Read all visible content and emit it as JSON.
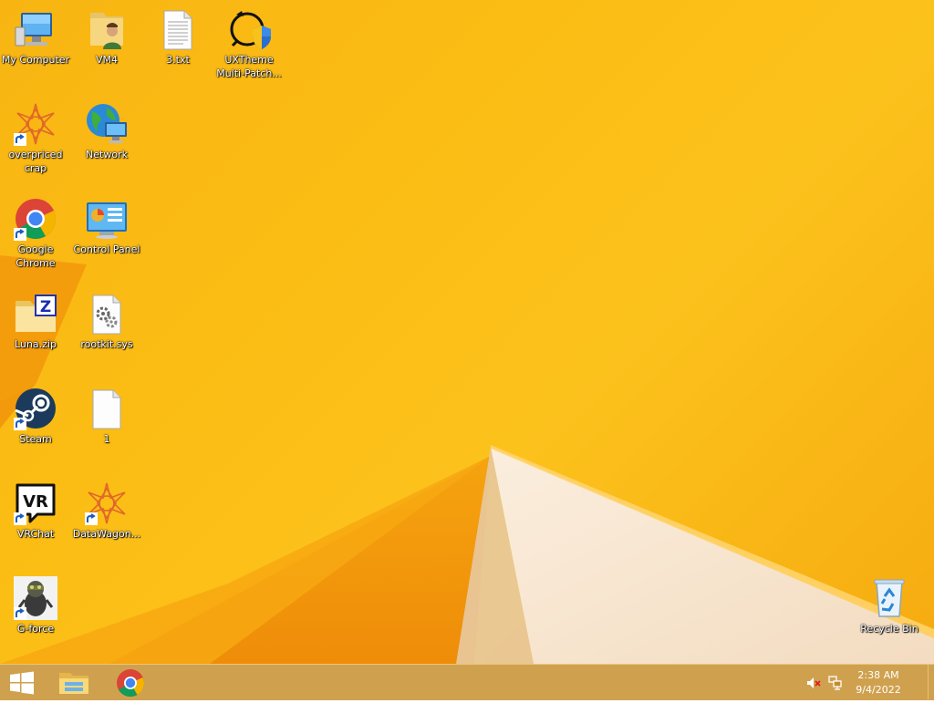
{
  "desktop": {
    "icons": [
      {
        "label": "My Computer",
        "icon": "computer-icon"
      },
      {
        "label": "VM4",
        "icon": "user-folder-icon"
      },
      {
        "label": "3.txt",
        "icon": "text-file-icon"
      },
      {
        "label": "UXTheme Multi-Patch...",
        "icon": "uxtheme-patcher-icon"
      },
      {
        "label": "overpriced crap",
        "icon": "ornament-shortcut-icon"
      },
      {
        "label": "Network",
        "icon": "network-globe-icon"
      },
      {
        "label": "Google Chrome",
        "icon": "chrome-icon"
      },
      {
        "label": "Control Panel",
        "icon": "control-panel-icon"
      },
      {
        "label": "Luna.zip",
        "icon": "zip-folder-icon"
      },
      {
        "label": "rootkit.sys",
        "icon": "system-file-icon"
      },
      {
        "label": "Steam",
        "icon": "steam-icon"
      },
      {
        "label": "1",
        "icon": "blank-file-icon"
      },
      {
        "label": "VRChat",
        "icon": "vrchat-icon"
      },
      {
        "label": "DataWagon...",
        "icon": "ornament-shortcut-icon"
      },
      {
        "label": "G-force",
        "icon": "g-force-icon"
      },
      {
        "label": "Recycle Bin",
        "icon": "recycle-bin-icon"
      }
    ]
  },
  "taskbar": {
    "pinned": [
      {
        "name": "File Explorer",
        "icon": "file-explorer-icon"
      },
      {
        "name": "Google Chrome",
        "icon": "chrome-icon"
      }
    ],
    "clock": {
      "time": "2:38 AM",
      "date": "9/4/2022"
    },
    "tray": [
      "volume-muted-icon",
      "network-icon"
    ]
  },
  "colors": {
    "wallpaper": "#fbbd14",
    "taskbar": "#c48c28",
    "label_text": "#ffffff"
  }
}
